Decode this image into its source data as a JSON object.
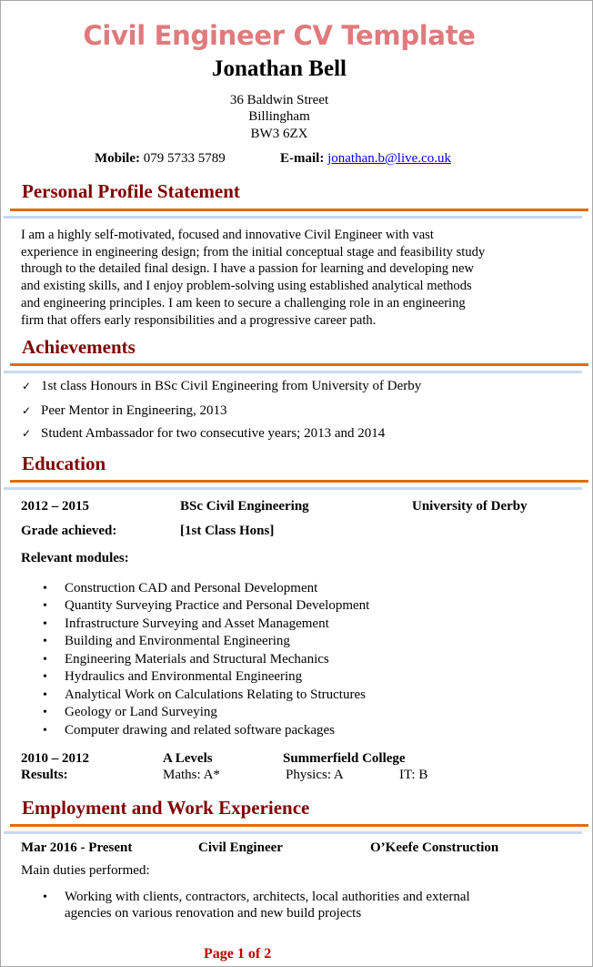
{
  "header": {
    "title": "Civil Engineer CV Template",
    "name": "Jonathan Bell",
    "address": [
      "36 Baldwin Street",
      "Billingham",
      "BW3 6ZX"
    ],
    "mobile_label": "Mobile:",
    "mobile_value": "079 5733 5789",
    "email_label": "E-mail:",
    "email_value": "jonathan.b@live.co.uk"
  },
  "colors": {
    "title": "#e07a7c",
    "section_heading": "#7f0000",
    "rule_orange": "#e36c0a",
    "rule_blue": "#c6d9f1",
    "link": "#0000ee",
    "footer": "#c00000"
  },
  "profile": {
    "heading": "Personal Profile Statement",
    "lines": [
      "I am a highly self-motivated, focused and innovative Civil Engineer with vast",
      "experience in engineering design; from the initial conceptual stage and feasibility study",
      "through to the detailed final design. I have a passion for learning and developing new",
      "and existing skills, and I enjoy problem-solving using established analytical methods",
      "and engineering principles. I am keen to secure a challenging role in an engineering",
      "firm that offers early responsibilities and a progressive career path."
    ]
  },
  "achievements": {
    "heading": "Achievements",
    "icon": "checkmark-icon",
    "items": [
      "1st class Honours in BSc Civil Engineering from University of Derby",
      "Peer Mentor in Engineering, 2013",
      "Student Ambassador for two consecutive years; 2013 and 2014"
    ]
  },
  "education": {
    "heading": "Education",
    "degree": {
      "dates": "2012 – 2015",
      "qualification": "BSc Civil Engineering",
      "institution": "University of Derby",
      "grade_label": "Grade achieved:",
      "grade_value": "[1st Class Hons]",
      "modules_label": "Relevant modules:",
      "modules": [
        "Construction CAD and Personal Development",
        "Quantity Surveying Practice and Personal Development",
        "Infrastructure Surveying and Asset Management",
        "Building and Environmental Engineering",
        "Engineering Materials and Structural Mechanics",
        "Hydraulics and Environmental Engineering",
        "Analytical Work on Calculations Relating to Structures",
        "Geology or Land Surveying",
        "Computer drawing and related software packages"
      ]
    },
    "alevels": {
      "dates": "2010 – 2012",
      "qualification": "A Levels",
      "institution": "Summerfield College",
      "results_label": "Results:",
      "results": [
        "Maths: A*",
        "Physics: A",
        "IT: B"
      ]
    }
  },
  "employment": {
    "heading": "Employment and Work Experience",
    "jobs": [
      {
        "dates": "Mar 2016 - Present",
        "title": "Civil Engineer",
        "company": "O’Keefe Construction",
        "duties_label": "Main duties performed:",
        "duties": [
          [
            "Working with clients, contractors, architects, local authorities and external",
            "agencies on various renovation and new build projects"
          ]
        ]
      }
    ]
  },
  "footer": {
    "page_label": "Page 1 of 2"
  }
}
